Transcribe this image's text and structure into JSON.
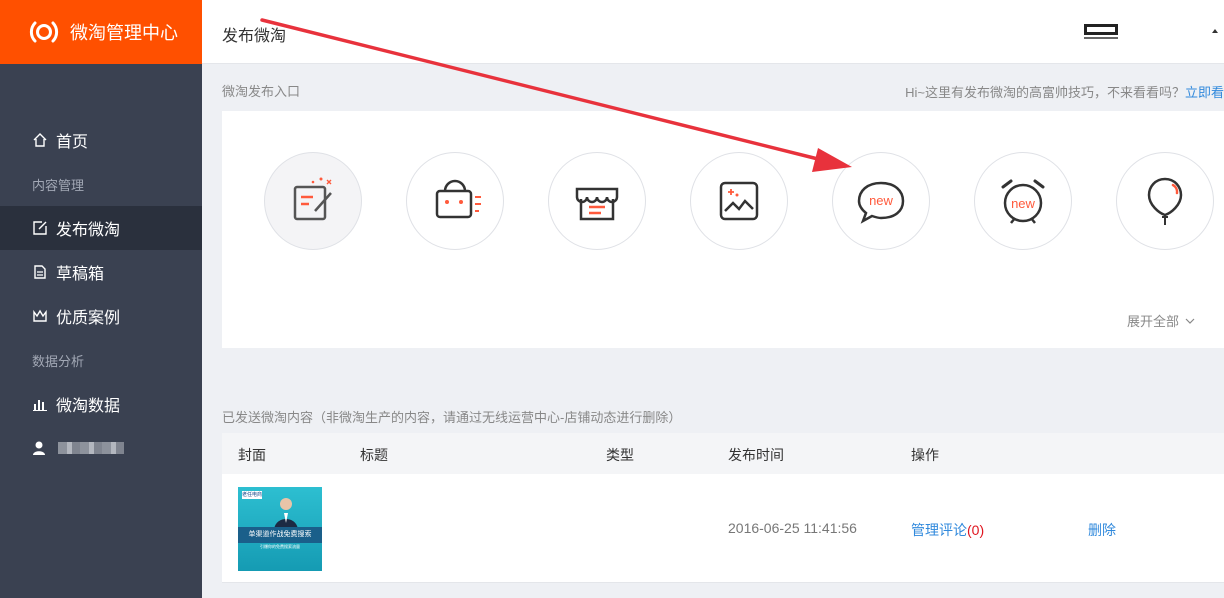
{
  "brand": {
    "name": "微淘管理中心",
    "color": "#ff5000"
  },
  "sidebar": {
    "items": [
      {
        "label": "首页",
        "icon": "home-icon"
      },
      {
        "section": "内容管理"
      },
      {
        "label": "发布微淘",
        "icon": "edit-icon",
        "active": true
      },
      {
        "label": "草稿箱",
        "icon": "draft-icon"
      },
      {
        "label": "优质案例",
        "icon": "crown-icon"
      },
      {
        "section": "数据分析"
      },
      {
        "label": "微淘数据",
        "icon": "bar-chart-icon"
      },
      {
        "icon": "user-icon"
      }
    ]
  },
  "header": {
    "title": "发布微淘",
    "user_logo": "user-brand-logo"
  },
  "entry": {
    "caption": "微淘发布入口",
    "tip_text": "Hi~这里有发布微淘的高富帅技巧，不来看看吗？",
    "tip_link": "立即看",
    "circle_icons": [
      "write-post-icon",
      "shopping-bag-icon",
      "shop-icon",
      "image-icon",
      "new-chat-icon",
      "new-alarm-clock-icon",
      "balloon-icon"
    ],
    "expand_label": "展开全部"
  },
  "sent": {
    "caption": "已发送微淘内容（非微淘生产的内容，请通过无线运营中心-店铺动态进行删除）",
    "columns": [
      "封面",
      "标题",
      "类型",
      "发布时间",
      "操作"
    ],
    "rows": [
      {
        "title": "",
        "type": "",
        "time": "2016-06-25 11:41:56",
        "manage_label": "管理评论",
        "comment_count": "(0)",
        "delete_label": "删除",
        "thumb_brand": "老任电商",
        "thumb_headline": "单渠道作战免费搜索",
        "thumb_sub": "引爆你的免费搜索流量"
      }
    ]
  },
  "colors": {
    "sidebar_bg": "#3a4151",
    "sidebar_active": "#2a303d",
    "link": "#3089dc",
    "arrow": "#e8323c"
  }
}
